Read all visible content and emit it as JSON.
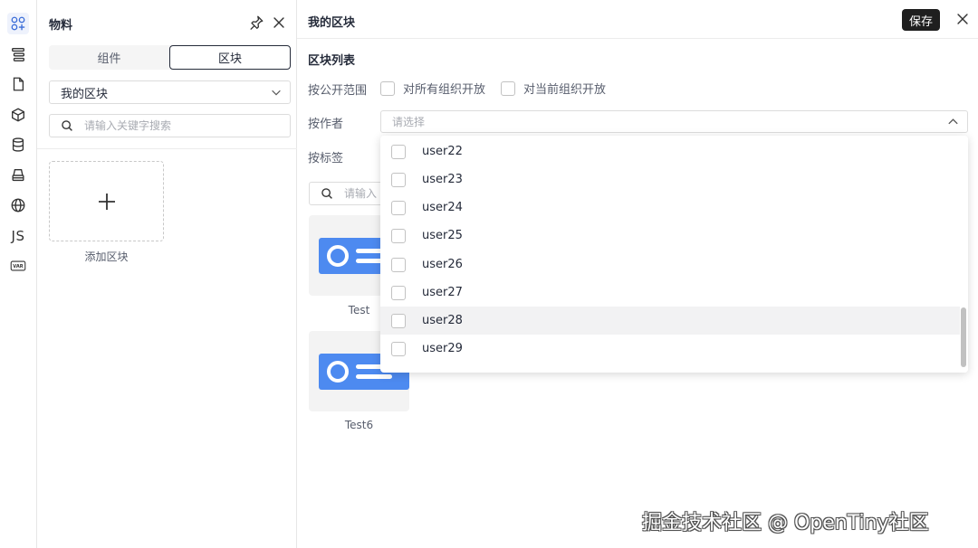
{
  "colors": {
    "accent": "#3b6dd8",
    "block_icon_blue": "#4d8af0",
    "save_button_bg": "#1f1f1f"
  },
  "rail": {
    "icons": [
      "components-icon",
      "outline-tree-icon",
      "page-icon",
      "cube-icon",
      "database-icon",
      "layers-icon",
      "globe-icon",
      "js-icon",
      "var-icon"
    ],
    "js_label": "JS",
    "var_label": "VAR"
  },
  "materials": {
    "title": "物料",
    "tabs": [
      "组件",
      "区块"
    ],
    "active_tab": "区块",
    "group_select": "我的区块",
    "search_placeholder": "请输入关键字搜索",
    "add_block_label": "添加区块"
  },
  "main": {
    "title": "我的区块",
    "save_label": "保存",
    "section_title": "区块列表",
    "filter_public_label": "按公开范围",
    "public_options": [
      "对所有组织开放",
      "对当前组织开放"
    ],
    "filter_author_label": "按作者",
    "author_placeholder": "请选择",
    "filter_tag_label": "按标签",
    "search_placeholder": "请输入",
    "blocks": [
      {
        "name": "Test"
      },
      {
        "name": "Test6"
      }
    ]
  },
  "author_dropdown": {
    "options": [
      "user22",
      "user23",
      "user24",
      "user25",
      "user26",
      "user27",
      "user28",
      "user29"
    ],
    "hovered": "user28"
  },
  "watermark": "掘金技术社区 @ OpenTiny社区"
}
